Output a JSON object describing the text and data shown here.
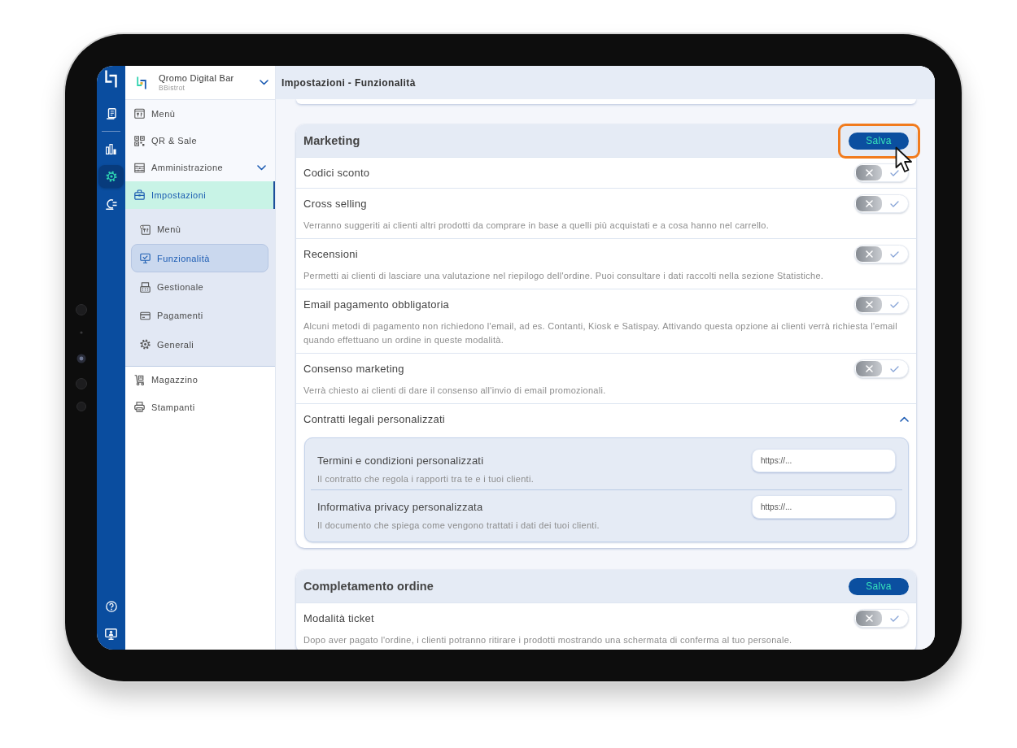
{
  "rail": {
    "items": [
      {
        "selected": false
      },
      {
        "selected": false
      },
      {
        "selected": true
      },
      {
        "selected": false
      }
    ]
  },
  "venue": {
    "name": "Qromo Digital Bar",
    "subtitle": "BBistrot"
  },
  "sidebar": {
    "items": [
      {
        "label": "Menù",
        "selected": false
      },
      {
        "label": "QR & Sale",
        "selected": false
      },
      {
        "label": "Amministrazione",
        "selected": false,
        "expanded": false
      },
      {
        "label": "Impostazioni",
        "selected": true,
        "children": [
          {
            "label": "Menù",
            "selected": false
          },
          {
            "label": "Funzionalità",
            "selected": true
          },
          {
            "label": "Gestionale",
            "selected": false
          },
          {
            "label": "Pagamenti",
            "selected": false
          },
          {
            "label": "Generali",
            "selected": false
          }
        ]
      },
      {
        "label": "Magazzino",
        "selected": false
      },
      {
        "label": "Stampanti",
        "selected": false
      }
    ]
  },
  "header": {
    "title": "Impostazioni - Funzionalità"
  },
  "sections": [
    {
      "title": "Marketing",
      "save_button": {
        "label": "Salva",
        "highlighted": true
      },
      "settings": [
        {
          "kind": "toggle",
          "label": "Codici sconto",
          "on": false
        },
        {
          "kind": "toggle",
          "label": "Cross selling",
          "on": false,
          "description": "Verranno suggeriti ai clienti altri prodotti da comprare in base a quelli più acquistati e a cosa hanno nel carrello."
        },
        {
          "kind": "toggle",
          "label": "Recensioni",
          "on": false,
          "description": "Permetti ai clienti di lasciare una valutazione nel riepilogo dell'ordine. Puoi consultare i dati raccolti nella sezione Statistiche."
        },
        {
          "kind": "toggle",
          "label": "Email pagamento obbligatoria",
          "on": false,
          "description": "Alcuni metodi di pagamento non richiedono l'email, ad es. Contanti, Kiosk e Satispay. Attivando questa opzione ai clienti verrà richiesta l'email quando effettuano un ordine in queste modalità."
        },
        {
          "kind": "toggle",
          "label": "Consenso marketing",
          "on": false,
          "description": "Verrà chiesto ai clienti di dare il consenso all'invio di email promozionali."
        },
        {
          "kind": "group",
          "label": "Contratti legali personalizzati",
          "expanded": true,
          "fields": [
            {
              "label": "Termini e condizioni personalizzati",
              "description": "Il contratto che regola i rapporti tra te e i tuoi clienti.",
              "placeholder": "https://..."
            },
            {
              "label": "Informativa privacy personalizzata",
              "description": "Il documento che spiega come vengono trattati i dati dei tuoi clienti.",
              "placeholder": "https://..."
            }
          ]
        }
      ]
    },
    {
      "title": "Completamento ordine",
      "save_button": {
        "label": "Salva",
        "highlighted": false
      },
      "settings": [
        {
          "kind": "toggle",
          "label": "Modalità ticket",
          "on": false,
          "description": "Dopo aver pagato l'ordine, i clienti potranno ritirare i prodotti mostrando una schermata di conferma al tuo personale."
        }
      ]
    }
  ]
}
